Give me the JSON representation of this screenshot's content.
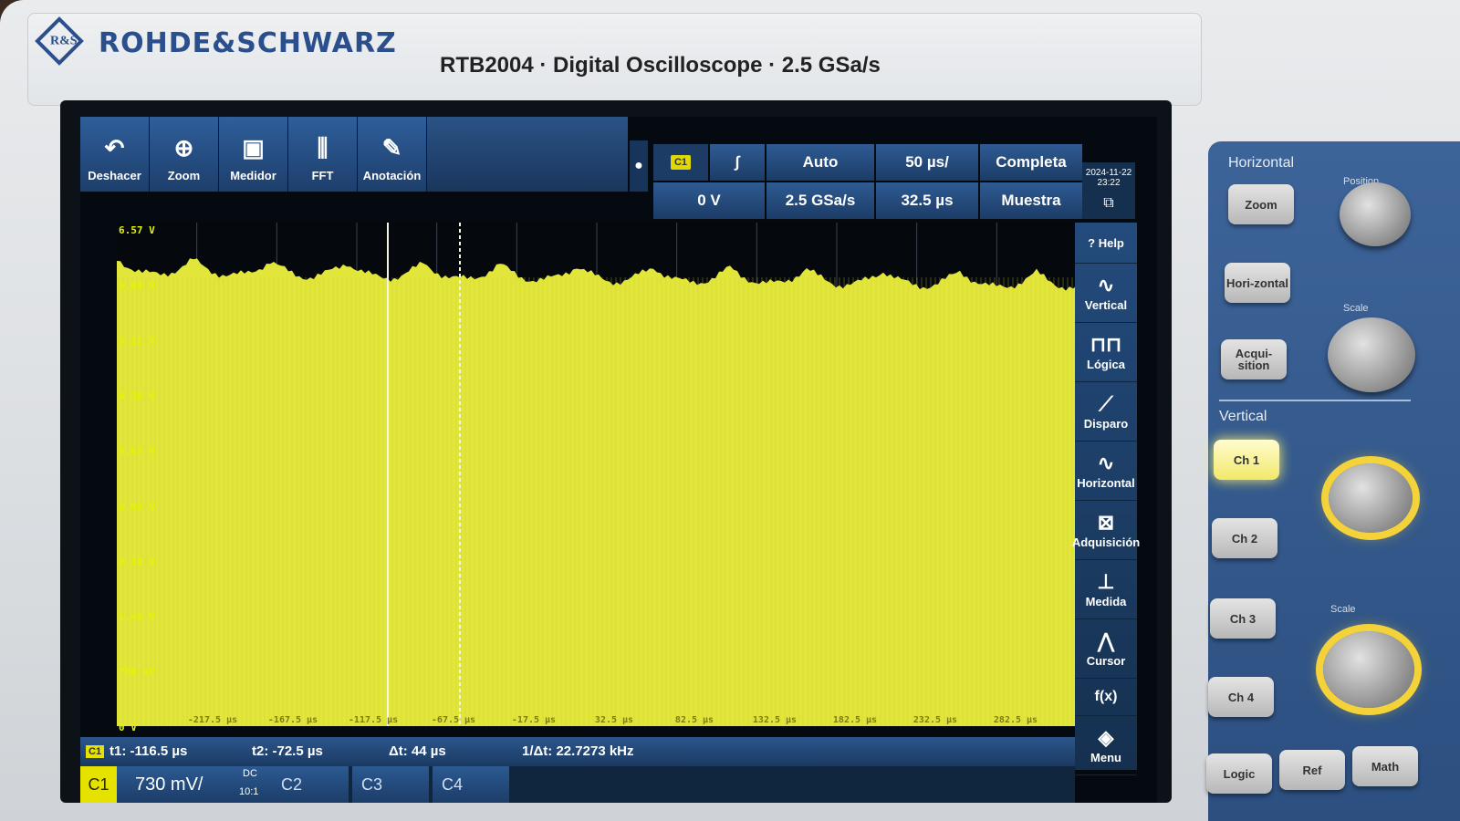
{
  "device": {
    "brand": "ROHDE&SCHWARZ",
    "logo_text": "R&S",
    "model": "RTB2004 · Digital Oscilloscope · 2.5 GSa/s"
  },
  "toolbar": [
    {
      "label": "Deshacer",
      "icon": "undo-icon",
      "glyph": "↶"
    },
    {
      "label": "Zoom",
      "icon": "zoom-icon",
      "glyph": "⊕"
    },
    {
      "label": "Medidor",
      "icon": "meter-icon",
      "glyph": "▣"
    },
    {
      "label": "FFT",
      "icon": "fft-icon",
      "glyph": "⫼"
    },
    {
      "label": "Anotación",
      "icon": "pencil-icon",
      "glyph": "✎"
    }
  ],
  "acquisition": {
    "trigger_source": "C1",
    "trigger_slope": "∫",
    "trigger_mode": "Auto",
    "time_scale": "50 µs/",
    "record": "Completa",
    "trigger_level": "0 V",
    "sample_rate": "2.5 GSa/s",
    "position": "32.5 µs",
    "acq_mode": "Muestra",
    "date": "2024-11-22",
    "time": "23:22"
  },
  "y_labels": [
    "6.57 V",
    "5.84 V",
    "5.11 V",
    "4.38 V",
    "3.65 V",
    "2.92 V",
    "2.19 V",
    "1.46 V",
    "730 mV",
    "0 V"
  ],
  "x_labels": [
    "-217.5 µs",
    "-167.5 µs",
    "-117.5 µs",
    "-67.5 µs",
    "-17.5 µs",
    "32.5 µs",
    "82.5 µs",
    "132.5 µs",
    "182.5 µs",
    "232.5 µs",
    "282.5 µs"
  ],
  "sidebar": [
    {
      "label": "Help",
      "icon": "help-icon",
      "glyph": "?"
    },
    {
      "label": "Vertical",
      "icon": "vertical-icon",
      "glyph": "∿"
    },
    {
      "label": "Lógica",
      "icon": "logic-icon",
      "glyph": "⊓⊓"
    },
    {
      "label": "Disparo",
      "icon": "trigger-icon",
      "glyph": "⟋"
    },
    {
      "label": "Horizontal",
      "icon": "horizontal-icon",
      "glyph": "∿"
    },
    {
      "label": "Adquisición",
      "icon": "acquisition-icon",
      "glyph": "⊠"
    },
    {
      "label": "Medida",
      "icon": "measure-icon",
      "glyph": "⊥"
    },
    {
      "label": "Cursor",
      "icon": "cursor-icon",
      "glyph": "⋀"
    },
    {
      "label": "f(x)",
      "icon": "math-icon",
      "glyph": ""
    },
    {
      "label": "Menu",
      "icon": "menu-icon",
      "glyph": "◈"
    }
  ],
  "cursors": {
    "source": "C1",
    "t1": "t1: -116.5 µs",
    "t2": "t2: -72.5 µs",
    "dt": "Δt: 44 µs",
    "inv_dt": "1/Δt: 22.7273 kHz"
  },
  "channels": {
    "ch1_label": "C1",
    "ch1_scale": "730 mV/",
    "ch1_coupling": "DC",
    "ch1_probe": "10:1",
    "others": [
      "C2",
      "C3",
      "C4"
    ]
  },
  "panel": {
    "horizontal_title": "Horizontal",
    "vertical_title": "Vertical",
    "position_label": "Position",
    "scale_label": "Scale",
    "buttons_h": [
      "Zoom",
      "Hori-zontal",
      "Acqui-sition"
    ],
    "buttons_v": [
      "Ch 1",
      "Ch 2",
      "Ch 3",
      "Ch 4"
    ],
    "buttons_bottom": [
      "Logic",
      "Ref",
      "Math"
    ]
  },
  "colors": {
    "waveform": "#e3e63a",
    "ui_blue": "#234b7c",
    "panel_blue": "#3d6499",
    "ch1_yellow": "#e5e200"
  }
}
